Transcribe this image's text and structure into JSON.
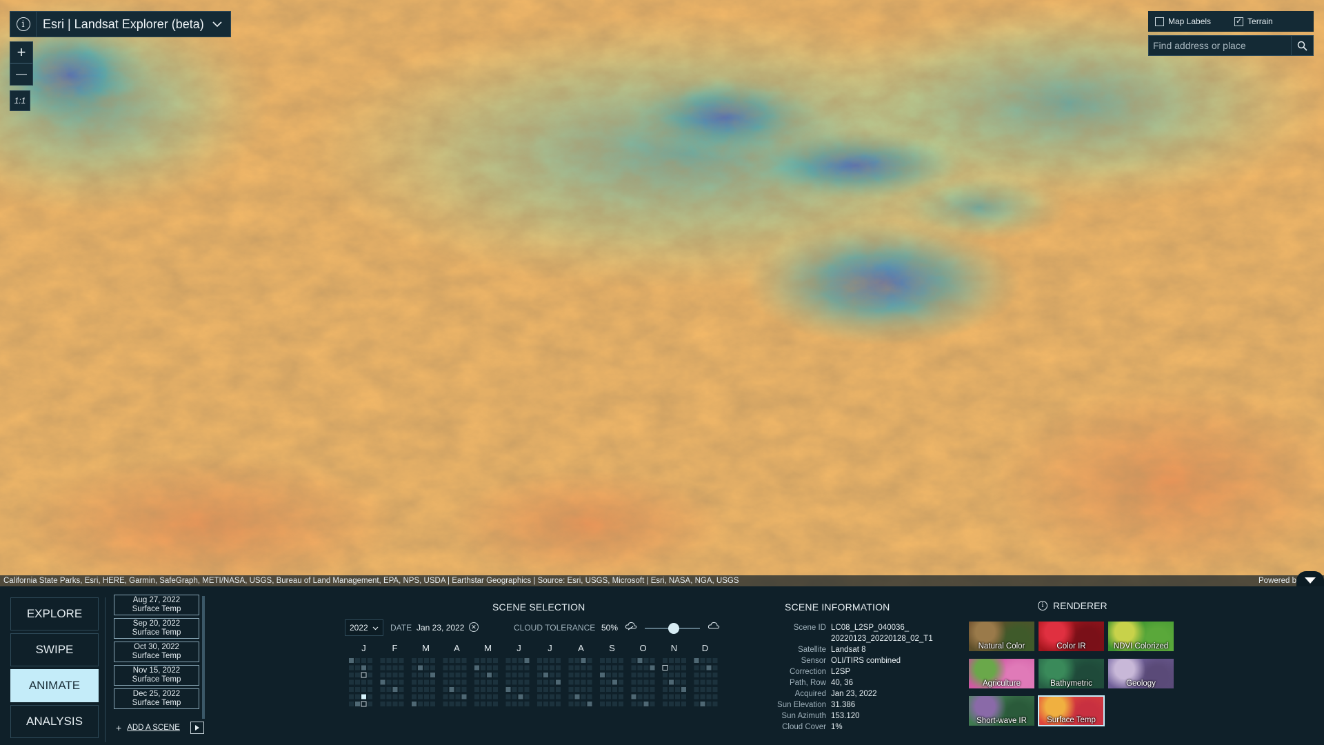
{
  "app": {
    "title": "Esri | Landsat Explorer (beta)"
  },
  "map_controls": {
    "zoom_in": "+",
    "zoom_out": "—",
    "scale": "1:1"
  },
  "layer_toggles": [
    {
      "label": "Map Labels",
      "checked": false
    },
    {
      "label": "Terrain",
      "checked": true
    }
  ],
  "search": {
    "placeholder": "Find address or place",
    "value": ""
  },
  "attribution": {
    "text": "California State Parks, Esri, HERE, Garmin, SafeGraph, METI/NASA, USGS, Bureau of Land Management, EPA, NPS, USDA | Earthstar Geographics | Source: Esri, USGS, Microsoft | Esri, NASA, NGA, USGS",
    "powered": "Powered b"
  },
  "modes": [
    {
      "label": "EXPLORE",
      "active": false
    },
    {
      "label": "SWIPE",
      "active": false
    },
    {
      "label": "ANIMATE",
      "active": true
    },
    {
      "label": "ANALYSIS",
      "active": false
    }
  ],
  "animation_scenes": [
    {
      "date": "Aug 27, 2022",
      "renderer": "Surface Temp"
    },
    {
      "date": "Sep 20, 2022",
      "renderer": "Surface Temp"
    },
    {
      "date": "Oct 30, 2022",
      "renderer": "Surface Temp"
    },
    {
      "date": "Nov 15, 2022",
      "renderer": "Surface Temp"
    },
    {
      "date": "Dec 25, 2022",
      "renderer": "Surface Temp"
    }
  ],
  "add_scene_label": "ADD A SCENE",
  "scene_selection": {
    "title": "SCENE SELECTION",
    "year": "2022",
    "date_label": "DATE",
    "date_value": "Jan 23, 2022",
    "cloud_label": "CLOUD TOLERANCE",
    "cloud_value": "50%",
    "cloud_fraction": 0.5,
    "months": [
      "J",
      "F",
      "M",
      "A",
      "M",
      "J",
      "J",
      "A",
      "S",
      "O",
      "N",
      "D"
    ]
  },
  "scene_information": {
    "title": "SCENE INFORMATION",
    "rows": [
      {
        "key": "Scene ID",
        "value": "LC08_L2SP_040036_ 20220123_20220128_02_T1"
      },
      {
        "key": "Satellite",
        "value": "Landsat 8"
      },
      {
        "key": "Sensor",
        "value": "OLI/TIRS combined"
      },
      {
        "key": "Correction",
        "value": "L2SP"
      },
      {
        "key": "Path, Row",
        "value": "40, 36"
      },
      {
        "key": "Acquired",
        "value": "Jan 23, 2022"
      },
      {
        "key": "Sun Elevation",
        "value": "31.386"
      },
      {
        "key": "Sun Azimuth",
        "value": "153.120"
      },
      {
        "key": "Cloud Cover",
        "value": "1%"
      }
    ]
  },
  "renderer": {
    "title": "RENDERER",
    "options": [
      {
        "label": "Natural Color",
        "active": false,
        "colors": [
          "#6b4a2a",
          "#9a7a4a",
          "#3f5a2a"
        ]
      },
      {
        "label": "Color IR",
        "active": false,
        "colors": [
          "#b81820",
          "#e03040",
          "#7a1018"
        ]
      },
      {
        "label": "NDVI Colorized",
        "active": false,
        "colors": [
          "#2f8a2a",
          "#c8d24a",
          "#5aa83a"
        ]
      },
      {
        "label": "Agriculture",
        "active": false,
        "colors": [
          "#c84a9a",
          "#6aa84a",
          "#e07ab8"
        ]
      },
      {
        "label": "Bathymetric",
        "active": false,
        "colors": [
          "#2a6a4a",
          "#3a8a5a",
          "#1f4a3a"
        ]
      },
      {
        "label": "Geology",
        "active": false,
        "colors": [
          "#7a6aa8",
          "#c8b8d8",
          "#5a4a78"
        ]
      },
      {
        "label": "Short-wave IR",
        "active": false,
        "colors": [
          "#4a8a5a",
          "#8a6aa8",
          "#2a5a3a"
        ]
      },
      {
        "label": "Surface Temp",
        "active": true,
        "colors": [
          "#e8503a",
          "#f0b040",
          "#c83040"
        ]
      }
    ]
  }
}
